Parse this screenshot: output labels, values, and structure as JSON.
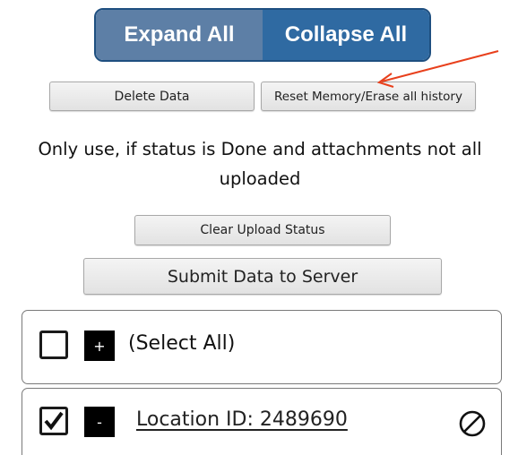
{
  "toolbar": {
    "expand_label": "Expand All",
    "collapse_label": "Collapse All"
  },
  "actions": {
    "delete_label": "Delete Data",
    "reset_label": "Reset Memory/Erase all history",
    "note": "Only use, if status is Done and attachments not all uploaded",
    "clear_label": "Clear Upload Status",
    "submit_label": "Submit Data to Server"
  },
  "list": {
    "select_all": {
      "toggle": "+",
      "label": "(Select All)",
      "checked": false
    },
    "items": [
      {
        "toggle": "-",
        "label": "Location ID: 2489690",
        "checked": true,
        "status_icon": "prohibited-icon"
      }
    ]
  },
  "colors": {
    "expand_bg": "#5d7fa6",
    "collapse_bg": "#2f6aa2",
    "annotation_arrow": "#e8401c"
  }
}
